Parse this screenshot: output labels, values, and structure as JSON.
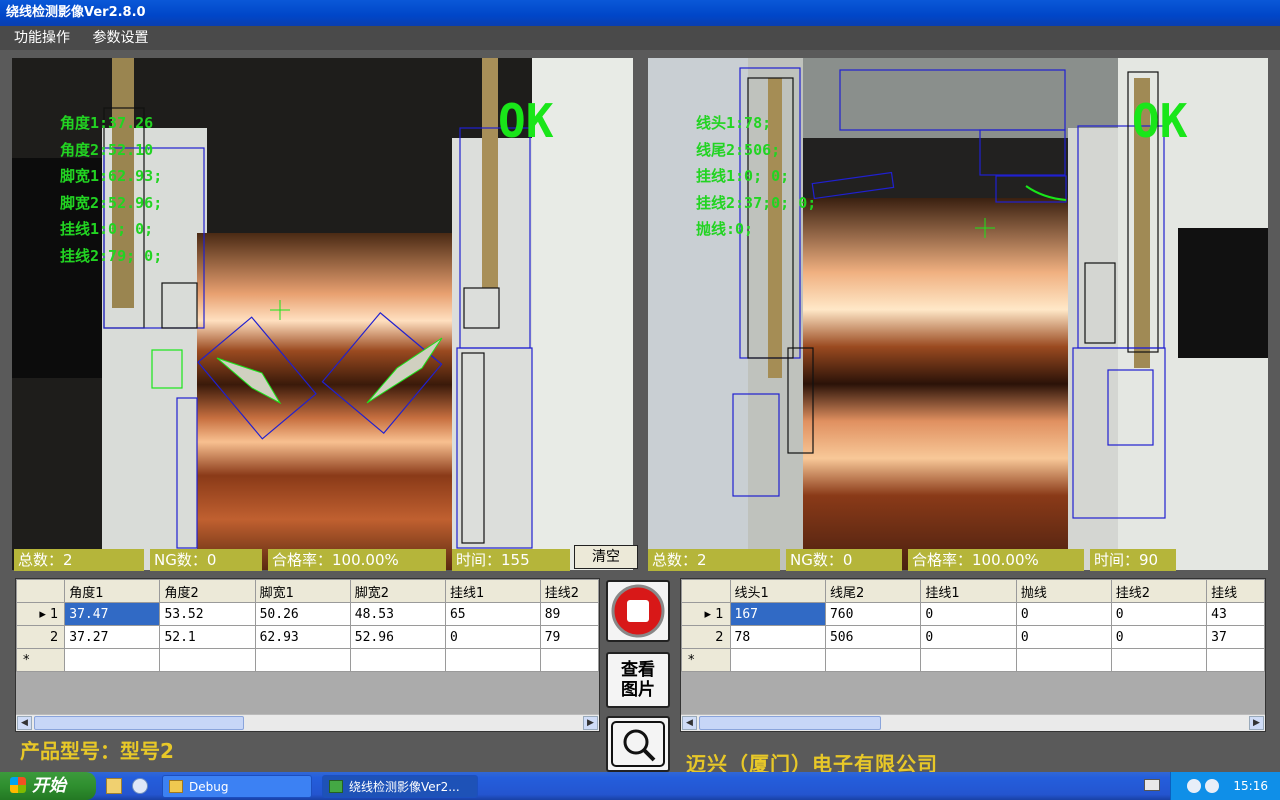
{
  "window": {
    "title": "绕线检测影像Ver2.8.0"
  },
  "menu": [
    {
      "label": "功能操作"
    },
    {
      "label": "参数设置"
    }
  ],
  "cameras": [
    {
      "status": "OK",
      "readout": [
        "角度1:37.26",
        "角度2:52.10",
        "脚宽1:62.93;",
        "脚宽2:52.96;",
        "挂线1:0; 0;",
        "挂线2:79; 0;"
      ],
      "stats": {
        "total": "总数：2",
        "ng": "NG数：0",
        "pass_rate": "合格率：100.00%",
        "time": "时间：155"
      }
    },
    {
      "status": "OK",
      "readout": [
        "线头1:78;",
        "线尾2:506;",
        "挂线1:0; 0;",
        "挂线2:37;0; 0;",
        "抛线:0;"
      ],
      "stats": {
        "total": "总数：2",
        "ng": "NG数：0",
        "pass_rate": "合格率：100.00%",
        "time": "时间：90"
      }
    }
  ],
  "clear_label": "清空",
  "grid_left": {
    "headers": [
      "角度1",
      "角度2",
      "脚宽1",
      "脚宽2",
      "挂线1",
      "挂线2"
    ],
    "rows": [
      {
        "num": "1",
        "cells": [
          "37.47",
          "53.52",
          "50.26",
          "48.53",
          "65",
          "89"
        ]
      },
      {
        "num": "2",
        "cells": [
          "37.27",
          "52.1",
          "62.93",
          "52.96",
          "0",
          "79"
        ]
      }
    ],
    "new_row": "*"
  },
  "grid_right": {
    "headers": [
      "线头1",
      "线尾2",
      "挂线1",
      "抛线",
      "挂线2",
      "挂线"
    ],
    "rows": [
      {
        "num": "1",
        "cells": [
          "167",
          "760",
          "0",
          "0",
          "0",
          "43"
        ]
      },
      {
        "num": "2",
        "cells": [
          "78",
          "506",
          "0",
          "0",
          "0",
          "37"
        ]
      }
    ],
    "new_row": "*"
  },
  "view_image_label": "查看\n图片",
  "product_model": "产品型号：型号2",
  "company": "迈兴（厦门）电子有限公司",
  "taskbar": {
    "start_label": "开始",
    "tasks": [
      "Debug",
      "绕线检测影像Ver2..."
    ],
    "clock": "15:16"
  },
  "icons": [
    "stop-record-icon",
    "magnifier-icon",
    "windows-flag-icon",
    "folder-icon",
    "keyboard-icon"
  ]
}
